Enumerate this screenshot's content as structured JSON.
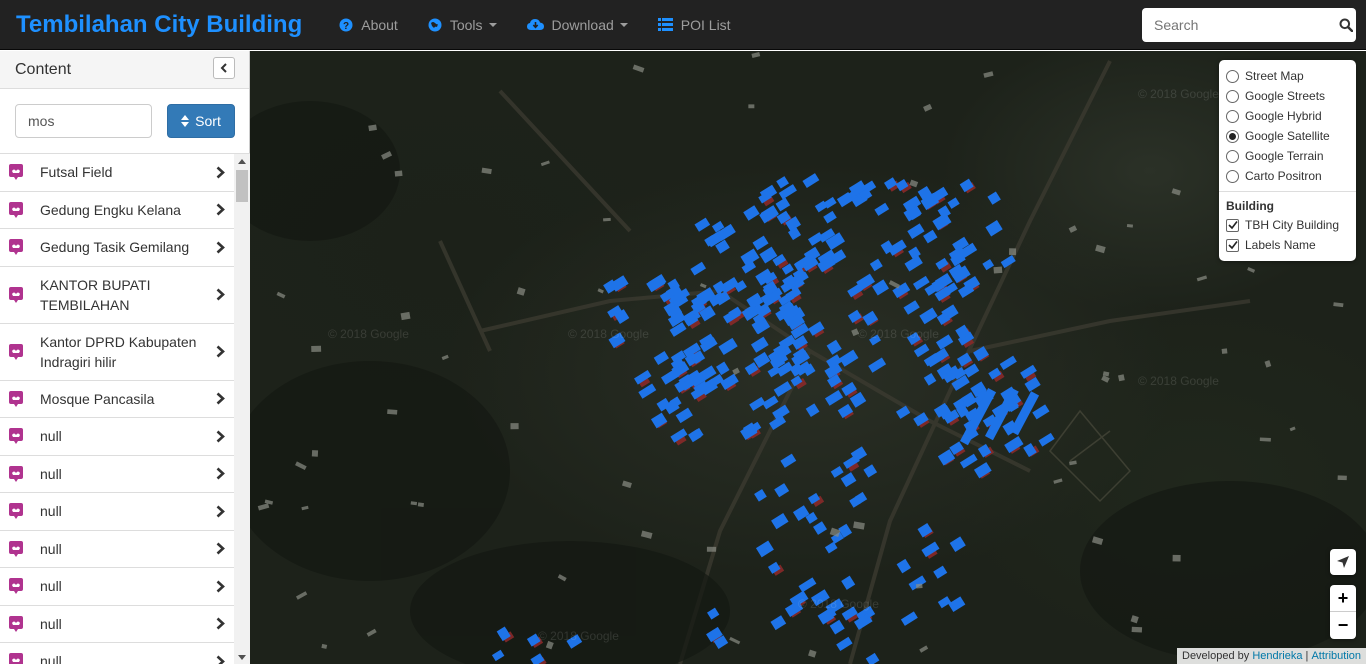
{
  "navbar": {
    "brand": "Tembilahan City Building",
    "items": [
      {
        "label": "About",
        "icon": "question-circle-icon"
      },
      {
        "label": "Tools",
        "icon": "globe-icon"
      },
      {
        "label": "Download",
        "icon": "cloud-download-icon"
      },
      {
        "label": "POI List",
        "icon": "list-icon"
      }
    ],
    "search_placeholder": "Search"
  },
  "sidebar": {
    "title": "Content",
    "filter_value": "mos",
    "sort_label": "Sort",
    "items": [
      {
        "label": "Futsal Field"
      },
      {
        "label": "Gedung Engku Kelana"
      },
      {
        "label": "Gedung Tasik Gemilang"
      },
      {
        "label": "KANTOR BUPATI TEMBILAHAN"
      },
      {
        "label": "Kantor DPRD Kabupaten Indragiri hilir"
      },
      {
        "label": "Mosque Pancasila"
      },
      {
        "label": "null"
      },
      {
        "label": "null"
      },
      {
        "label": "null"
      },
      {
        "label": "null"
      },
      {
        "label": "null"
      },
      {
        "label": "null"
      },
      {
        "label": "null"
      }
    ]
  },
  "layers": {
    "basemaps": [
      {
        "label": "Street Map",
        "selected": false
      },
      {
        "label": "Google Streets",
        "selected": false
      },
      {
        "label": "Google Hybrid",
        "selected": false
      },
      {
        "label": "Google Satellite",
        "selected": true
      },
      {
        "label": "Google Terrain",
        "selected": false
      },
      {
        "label": "Carto Positron",
        "selected": false
      }
    ],
    "group_title": "Building",
    "overlays": [
      {
        "label": "TBH City Building",
        "checked": true
      },
      {
        "label": "Labels Name",
        "checked": true
      }
    ]
  },
  "map": {
    "watermark": "© 2018 Google",
    "zoom_in": "+",
    "zoom_out": "−",
    "building_color": "#1e73e8",
    "roof_red_color": "#8a2a2a"
  },
  "attribution": {
    "prefix": "Developed by",
    "author": "Hendrieka",
    "separator": "|",
    "link": "Attribution"
  },
  "colors": {
    "brand": "#1e90ff",
    "navbar_bg": "#222222",
    "sort_button": "#337ab7",
    "poi_icon": "#b0338f"
  }
}
